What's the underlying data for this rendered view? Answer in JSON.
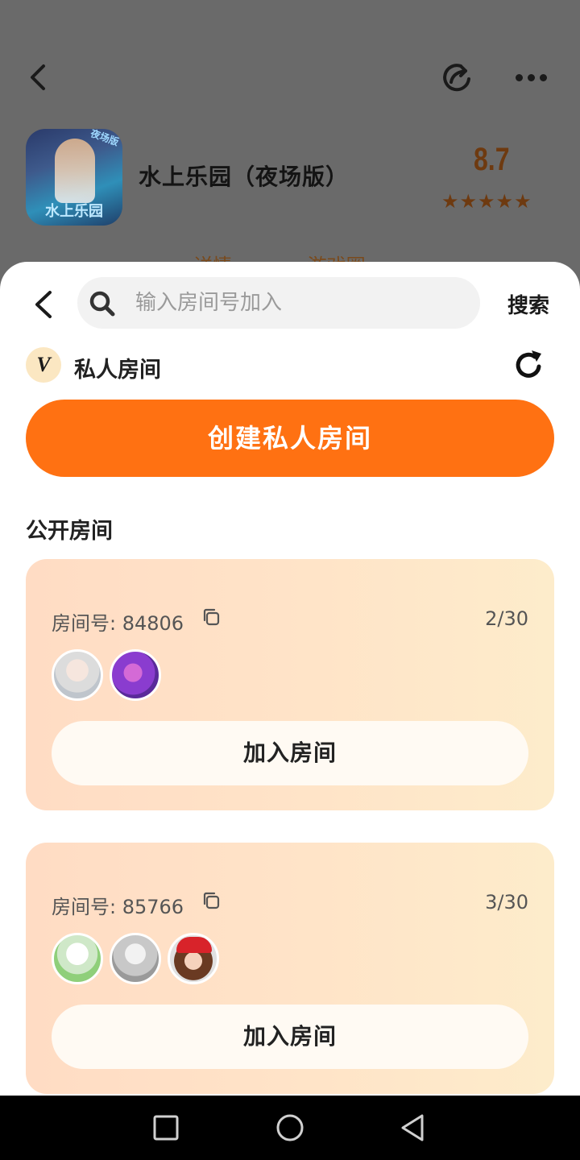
{
  "app": {
    "title": "水上乐园（夜场版）",
    "icon_text": "水上乐园",
    "icon_tag": "夜场版",
    "rating": "8.7",
    "stars": "★★★★★",
    "tabs": [
      "详情",
      "游戏圈"
    ]
  },
  "sheet": {
    "search": {
      "placeholder": "输入房间号加入",
      "button_label": "搜索"
    },
    "private": {
      "badge": "V",
      "label": "私人房间",
      "create_label": "创建私人房间"
    },
    "public": {
      "label": "公开房间",
      "rooms": [
        {
          "id_label": "房间号:  84806",
          "count": "2/30",
          "join_label": "加入房间"
        },
        {
          "id_label": "房间号:  85766",
          "count": "3/30",
          "join_label": "加入房间"
        }
      ]
    }
  },
  "colors": {
    "accent": "#ff7112",
    "rating": "#6e3a10",
    "card_start": "#ffdcc4",
    "card_end": "#fdeccb"
  }
}
